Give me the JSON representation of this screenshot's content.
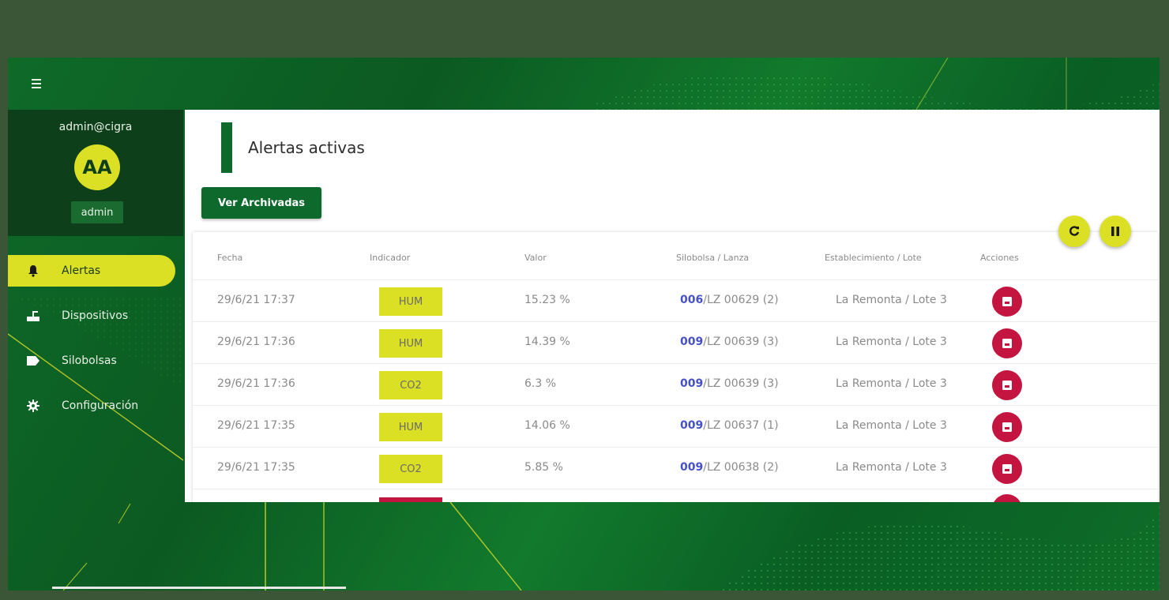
{
  "header": {
    "menu_icon": "menu-icon"
  },
  "user": {
    "email": "admin@cigra",
    "initials": "AA",
    "role": "admin"
  },
  "sidebar": {
    "items": [
      {
        "label": "Alertas",
        "icon": "bell-icon",
        "active": true
      },
      {
        "label": "Dispositivos",
        "icon": "device-icon",
        "active": false
      },
      {
        "label": "Silobolsas",
        "icon": "tag-icon",
        "active": false
      },
      {
        "label": "Configuración",
        "icon": "gear-icon",
        "active": false
      }
    ]
  },
  "main": {
    "title": "Alertas activas",
    "archived_button": "Ver Archivadas",
    "refresh_icon": "refresh-icon",
    "pause_icon": "pause-icon"
  },
  "table": {
    "headers": [
      "Fecha",
      "Indicador",
      "Valor",
      "Silobolsa / Lanza",
      "Establecimiento / Lote",
      "Acciones"
    ],
    "rows": [
      {
        "fecha": "29/6/21 17:37",
        "indicador": "HUM",
        "valor": "15.23 %",
        "silo": "006",
        "lanza": "/LZ 00629 (2)",
        "establecimiento": "La Remonta / Lote 3"
      },
      {
        "fecha": "29/6/21 17:36",
        "indicador": "HUM",
        "valor": "14.39 %",
        "silo": "009",
        "lanza": "/LZ 00639 (3)",
        "establecimiento": "La Remonta / Lote 3"
      },
      {
        "fecha": "29/6/21 17:36",
        "indicador": "CO2",
        "valor": "6.3 %",
        "silo": "009",
        "lanza": "/LZ 00639 (3)",
        "establecimiento": "La Remonta / Lote 3"
      },
      {
        "fecha": "29/6/21 17:35",
        "indicador": "HUM",
        "valor": "14.06 %",
        "silo": "009",
        "lanza": "/LZ 00637 (1)",
        "establecimiento": "La Remonta / Lote 3"
      },
      {
        "fecha": "29/6/21 17:35",
        "indicador": "CO2",
        "valor": "5.85 %",
        "silo": "009",
        "lanza": "/LZ 00638 (2)",
        "establecimiento": "La Remonta / Lote 3"
      }
    ],
    "action_icon": "archive-icon"
  },
  "colors": {
    "frame": "#3a5636",
    "brand_green": "#0d6a2c",
    "accent_yellow": "#dbe024",
    "danger_red": "#c41540",
    "link_blue": "#4650c8"
  }
}
